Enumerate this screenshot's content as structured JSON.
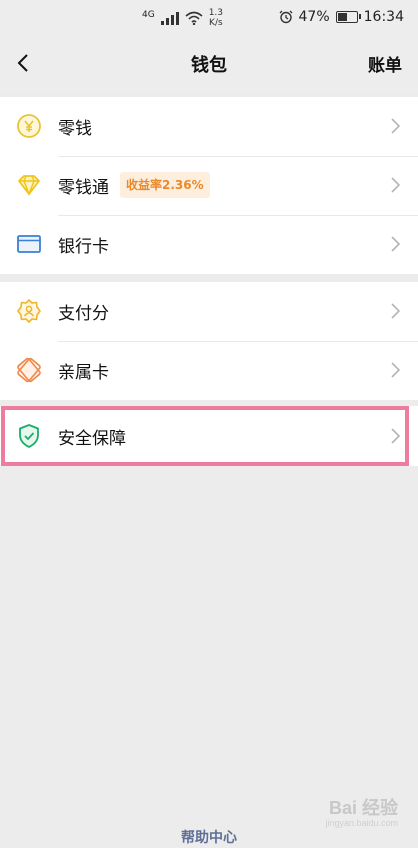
{
  "status_bar": {
    "network": "4G",
    "speed_value": "1.3",
    "speed_unit": "K/s",
    "battery": "47%",
    "time": "16:34"
  },
  "nav": {
    "title": "钱包",
    "right_label": "账单"
  },
  "groups": [
    {
      "items": [
        {
          "label": "零钱",
          "icon": "yuan-coin-icon"
        },
        {
          "label": "零钱通",
          "icon": "diamond-icon",
          "badge": "收益率2.36%"
        },
        {
          "label": "银行卡",
          "icon": "bank-card-icon"
        }
      ]
    },
    {
      "items": [
        {
          "label": "支付分",
          "icon": "score-badge-icon"
        },
        {
          "label": "亲属卡",
          "icon": "family-card-icon"
        }
      ]
    },
    {
      "items": [
        {
          "label": "安全保障",
          "icon": "shield-check-icon",
          "highlighted": true
        }
      ]
    }
  ],
  "footer": {
    "help_label": "帮助中心"
  },
  "watermark": {
    "text": "Bai 经验",
    "sub": "jingyan.baidu.com"
  },
  "colors": {
    "coin_yellow": "#e8c33a",
    "diamond_yellow": "#f0c419",
    "card_blue": "#3a7fd5",
    "score_orange": "#f0b429",
    "family_orange": "#f08a4b",
    "shield_green": "#1aad6a",
    "badge_bg": "#fdeede",
    "badge_text": "#e88a2a",
    "highlight_pink": "#ee7c9f",
    "help_link": "#5f6f98"
  }
}
